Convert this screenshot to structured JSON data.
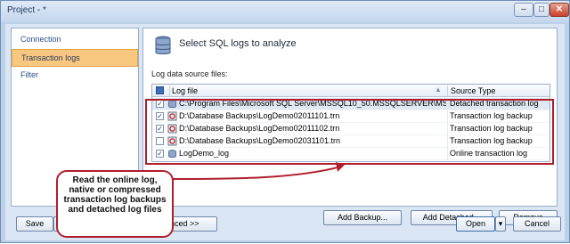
{
  "window": {
    "title": "Project - *",
    "minimize": "–",
    "maximize": "□",
    "close": "✕"
  },
  "sidebar": {
    "items": [
      {
        "label": "Connection",
        "selected": false
      },
      {
        "label": "Transaction logs",
        "selected": true
      },
      {
        "label": "Filter",
        "selected": false
      }
    ]
  },
  "main": {
    "header_title": "Select SQL logs to analyze",
    "header_icon": "database-icon",
    "source_label": "Log data source files:"
  },
  "grid": {
    "columns": [
      "Log file",
      "Source Type"
    ],
    "rows": [
      {
        "checked": true,
        "icon": "database-log-icon",
        "file": "C:\\Program Files\\Microsoft SQL Server\\MSSQL10_50.MSSQLSERVER\\MSSQL\\DAT",
        "type": "Detached transaction log"
      },
      {
        "checked": true,
        "icon": "backup-icon",
        "file": "D:\\Database Backups\\LogDemo02011101.trn",
        "type": "Transaction log backup"
      },
      {
        "checked": true,
        "icon": "backup-icon",
        "file": "D:\\Database Backups\\LogDemo02011102.trn",
        "type": "Transaction log backup"
      },
      {
        "checked": false,
        "icon": "backup-icon",
        "file": "D:\\Database Backups\\LogDemo02031101.trn",
        "type": "Transaction log backup"
      },
      {
        "checked": true,
        "icon": "database-log-icon",
        "file": "LogDemo_log",
        "type": "Online transaction log"
      }
    ]
  },
  "buttons": {
    "add_backup": "Add Backup...",
    "add_detached": "Add Detached...",
    "remove": "Remove",
    "save": "Save",
    "advanced": "nced >>",
    "open": "Open",
    "cancel": "Cancel"
  },
  "callout": {
    "lines": [
      "Read the online log,",
      "native or compressed",
      "transaction log backups",
      "and detached log files"
    ]
  },
  "colors": {
    "accent": "#b01e2c",
    "selection": "#f8c880",
    "frame": "#bcd0e8"
  }
}
